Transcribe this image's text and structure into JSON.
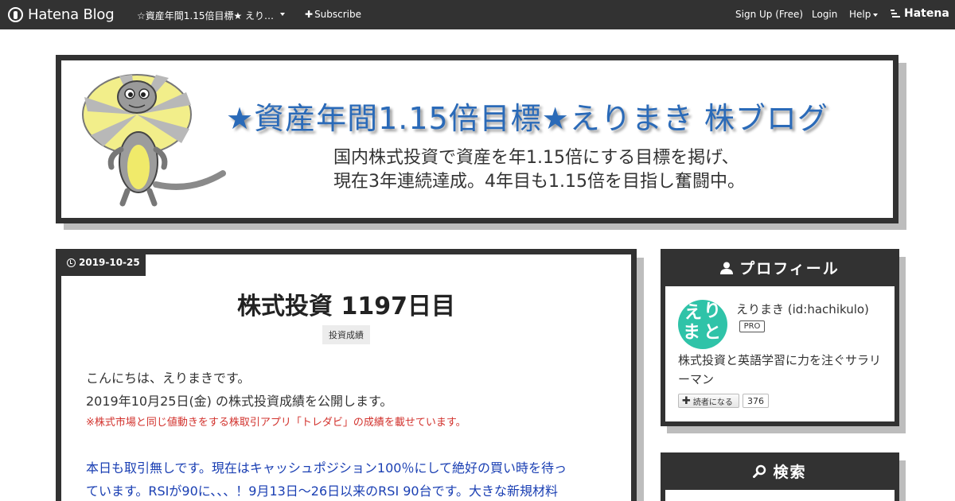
{
  "topbar": {
    "logo": "Hatena Blog",
    "blog_title": "☆資産年間1.15倍目標★ えり…",
    "subscribe": "Subscribe",
    "signup": "Sign Up (Free)",
    "login": "Login",
    "help": "Help",
    "hatena": "Hatena"
  },
  "banner": {
    "title": "★資産年間1.15倍目標★えりまき 株ブログ",
    "desc_line1": "国内株式投資で資産を年1.15倍にする目標を掲げ、",
    "desc_line2": "現在3年連続達成。4年目も1.15倍を目指し奮闘中。"
  },
  "article": {
    "date": "2019-10-25",
    "title": "株式投資 1197日目",
    "category": "投資成績",
    "line1": "こんにちは、えりまきです。",
    "line2": "2019年10月25日(金) の株式投資成績を公開します。",
    "note": "※株式市場と同じ値動きをする株取引アプリ「トレダビ」の成績を載せています。",
    "blue1": "本日も取引無しです。現在はキャッシュポジション100％にして絶好の買い時を待っ",
    "blue2": "ています。RSIが90に、、、！9月13日～26日以来のRSI 90台です。大きな新規材料"
  },
  "profile": {
    "heading": "プロフィール",
    "avatar_text_1": "え",
    "avatar_text_2": "り",
    "avatar_text_3": "ま",
    "avatar_text_4": "と",
    "name": "えりまき (id:hachikulo)",
    "pro": "PRO",
    "desc": "株式投資と英語学習に力を注ぐサラリーマン",
    "reader_button": "読者になる",
    "reader_count": "376"
  },
  "search": {
    "heading": "検索"
  },
  "colors": {
    "dark": "#323232",
    "banner_title": "#2a6ab8",
    "note_red": "#d2322d",
    "body_blue": "#1a3fb3",
    "avatar": "#2fc3a8"
  }
}
